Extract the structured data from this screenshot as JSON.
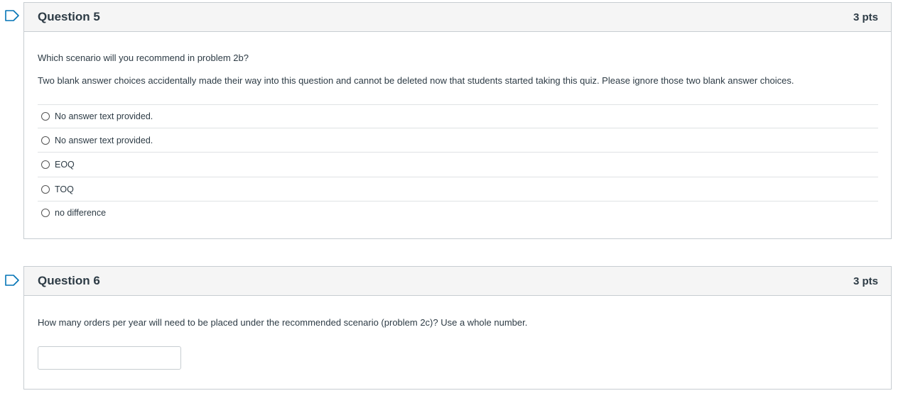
{
  "questions": [
    {
      "title": "Question 5",
      "points": "3 pts",
      "prompt": "Which scenario will you recommend in problem 2b?",
      "note": "Two blank answer choices accidentally made their way into this question and cannot be deleted now that students started taking this quiz. Please ignore those two blank answer choices.",
      "answers": [
        {
          "label": "No answer text provided."
        },
        {
          "label": "No answer text provided."
        },
        {
          "label": "EOQ"
        },
        {
          "label": "TOQ"
        },
        {
          "label": "no difference"
        }
      ]
    },
    {
      "title": "Question 6",
      "points": "3 pts",
      "prompt": "How many orders per year will need to be placed under the recommended scenario (problem 2c)? Use a whole number.",
      "input_value": ""
    }
  ],
  "colors": {
    "flag": "#0374b5",
    "header_bg": "#f5f5f5",
    "border": "#c7cdd1",
    "text": "#2d3b45"
  }
}
